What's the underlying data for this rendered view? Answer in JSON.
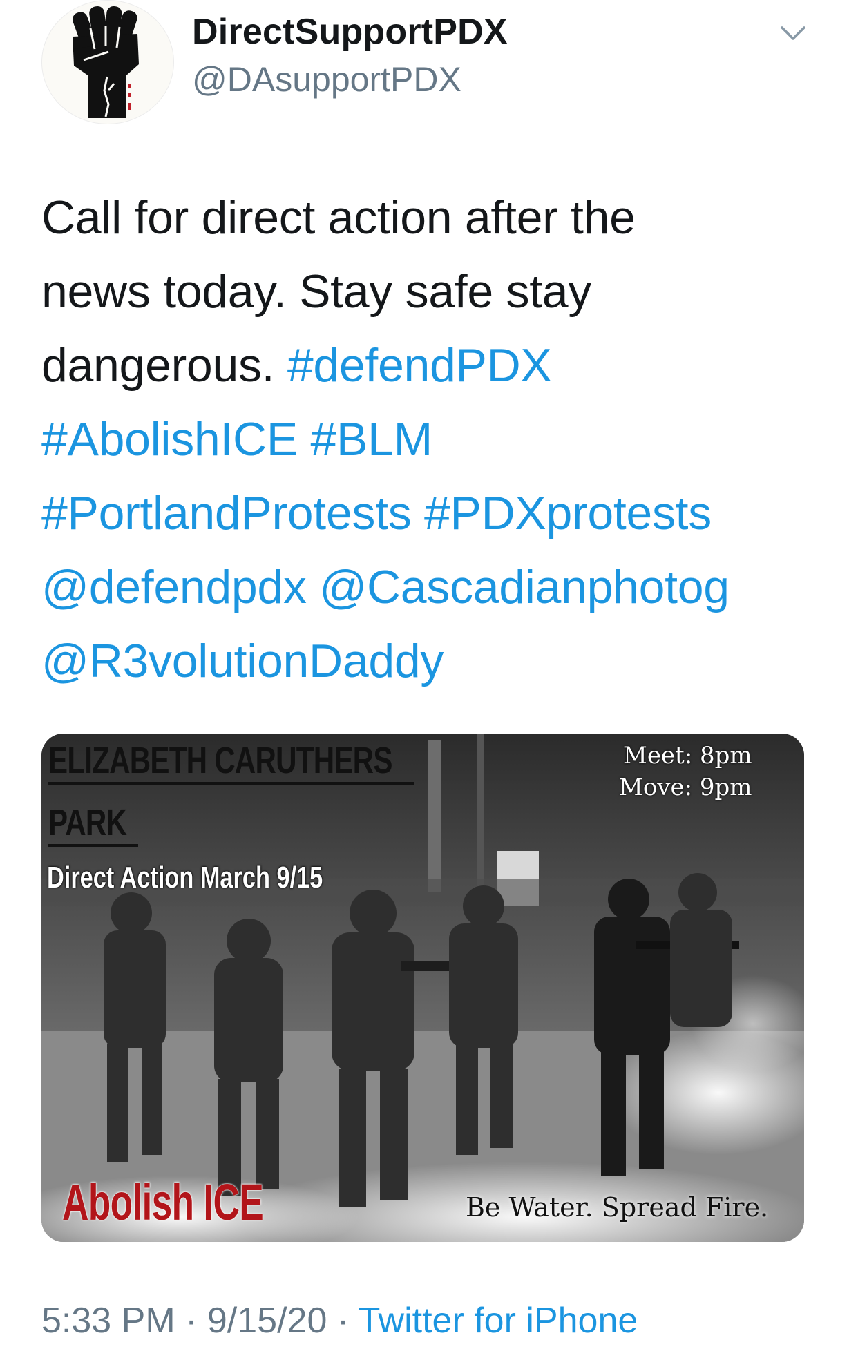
{
  "account": {
    "display_name": "DirectSupportPDX",
    "handle": "@DAsupportPDX",
    "avatar_icon": "raised-fist-icon"
  },
  "tweet": {
    "lines": [
      [
        {
          "text": "Call for direct action after the",
          "type": "text"
        }
      ],
      [
        {
          "text": "news today. Stay safe stay",
          "type": "text"
        }
      ],
      [
        {
          "text": "dangerous. ",
          "type": "text"
        },
        {
          "text": "#defendPDX",
          "type": "hashtag"
        }
      ],
      [
        {
          "text": "#AbolishICE",
          "type": "hashtag"
        },
        {
          "text": " ",
          "type": "text"
        },
        {
          "text": "#BLM",
          "type": "hashtag"
        }
      ],
      [
        {
          "text": "#PortlandProtests",
          "type": "hashtag"
        },
        {
          "text": " ",
          "type": "text"
        },
        {
          "text": "#PDXprotests",
          "type": "hashtag"
        }
      ],
      [
        {
          "text": "@defendpdx",
          "type": "mention"
        },
        {
          "text": " ",
          "type": "text"
        },
        {
          "text": "@Cascadianphotog",
          "type": "mention"
        }
      ],
      [
        {
          "text": "@R3volutionDaddy",
          "type": "mention"
        }
      ]
    ]
  },
  "media": {
    "title": "ELIZABETH CARUTHERS",
    "title_line2": "PARK",
    "subtitle": "Direct Action March 9/15",
    "meet": "Meet: 8pm",
    "move": "Move: 9pm",
    "slogan_left": "Abolish ICE",
    "slogan_right": "Be Water. Spread Fire."
  },
  "meta": {
    "time": "5:33 PM",
    "separator": " · ",
    "date": "9/15/20",
    "source": "Twitter for iPhone"
  },
  "colors": {
    "link": "#1b95e0",
    "secondary": "#657786",
    "text": "#14171a",
    "abolish_red": "#b2151a"
  }
}
